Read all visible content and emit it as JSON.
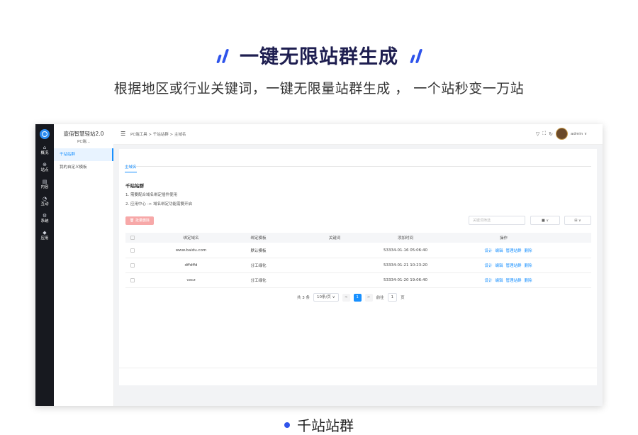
{
  "hero": {
    "title": "一键无限站群生成",
    "subtitle": "根据地区或行业关键词，一键无限量站群生成 ， 一个站秒变一万站"
  },
  "app": {
    "brand": "壹佰智慧轻站2.0",
    "brand_sub": "PC端...",
    "rail": [
      {
        "icon": "home-icon",
        "glyph": "⌂",
        "label": "概况"
      },
      {
        "icon": "site-icon",
        "glyph": "⊕",
        "label": "站点"
      },
      {
        "icon": "content-icon",
        "glyph": "▤",
        "label": "内容"
      },
      {
        "icon": "interact-icon",
        "glyph": "◔",
        "label": "互动"
      },
      {
        "icon": "system-icon",
        "glyph": "⚙",
        "label": "系统"
      },
      {
        "icon": "app-icon",
        "glyph": "◆",
        "label": "应用"
      }
    ],
    "menu": [
      "千站站群",
      "我的自定义模板"
    ],
    "breadcrumb": "PC端工具 > 千站站群 > 主域名",
    "user": "admin ∨",
    "tab": "主域名",
    "section_title": "千站站群",
    "hints": [
      "1. 需要配合域名绑定插件使用",
      "2. 应用中心 -> 域名绑定功能需要开启"
    ],
    "batch_delete": "批量删除",
    "keyword_placeholder": "关键词筛选",
    "select1": "■ ∨",
    "select2": "⊞ ∨",
    "columns": [
      "绑定域名",
      "绑定模板",
      "关键词",
      "添加时间",
      "操作"
    ],
    "rows": [
      {
        "domain": "www.baidu.com",
        "template": "默认模板",
        "keyword": "",
        "time": "53334-01-16 05:06:40"
      },
      {
        "domain": "dffdffd",
        "template": "分工绿化",
        "keyword": "",
        "time": "53334-01-21 10:23:20"
      },
      {
        "domain": "vxcz",
        "template": "分工绿化",
        "keyword": "",
        "time": "53334-01-20 19:06:40"
      }
    ],
    "row_actions": [
      "设计",
      "编辑",
      "管理站群",
      "删除"
    ],
    "pager": {
      "total": "共 3 条",
      "size": "10条/页 ∨",
      "prev": "<",
      "page": "1",
      "next": ">",
      "goto": "前往",
      "goto_value": "1",
      "page_unit": "页"
    }
  },
  "caption": "千站站群",
  "colors": {
    "accent": "#2f54eb",
    "link": "#1890ff",
    "danger_light": "#f7a8a8",
    "rail": "#17191f"
  }
}
